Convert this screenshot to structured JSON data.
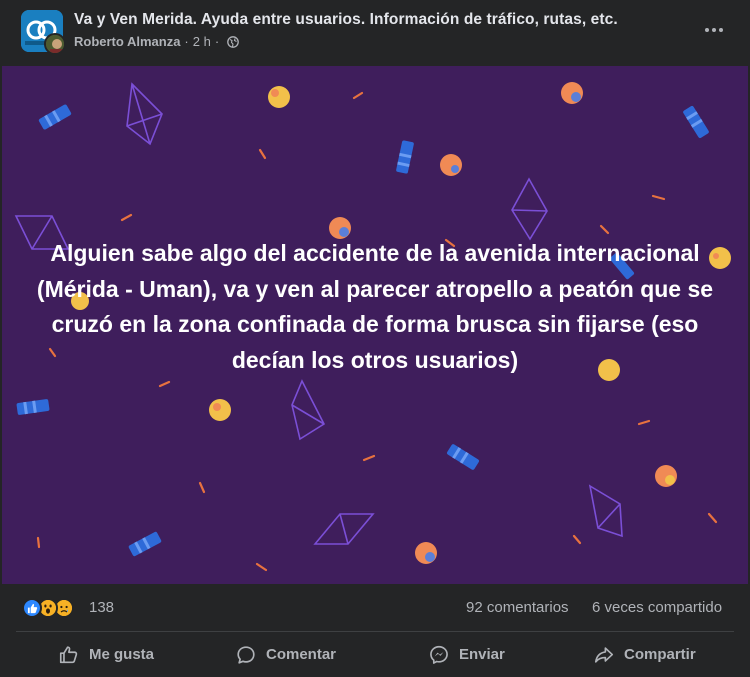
{
  "post": {
    "group_name": "Va y Ven Merida. Ayuda entre usuarios. Información de tráfico, rutas, etc.",
    "author": "Roberto Almanza",
    "separator": "·",
    "time": "2 h",
    "separator2": "·",
    "text": "Alguien sabe algo del accidente de la avenida internacional (Mérida - Uman), va y ven al parecer atropello a peatón que se cruzó en la zona confinada de forma brusca sin fijarse (eso decían los otros usuarios)",
    "background_color": "#3f1e5c"
  },
  "engagement": {
    "reaction_icons": [
      "like-icon",
      "wow-icon",
      "sad-icon"
    ],
    "reaction_count": "138",
    "comments": "92 comentarios",
    "shares": "6 veces compartido"
  },
  "actions": {
    "like": "Me gusta",
    "comment": "Comentar",
    "send": "Enviar",
    "share": "Compartir"
  },
  "colors": {
    "surface": "#242526",
    "text_primary": "#e4e6eb",
    "text_secondary": "#b0b3b8",
    "like_blue": "#2d88ff",
    "emoji_yellow": "#f7b125"
  }
}
